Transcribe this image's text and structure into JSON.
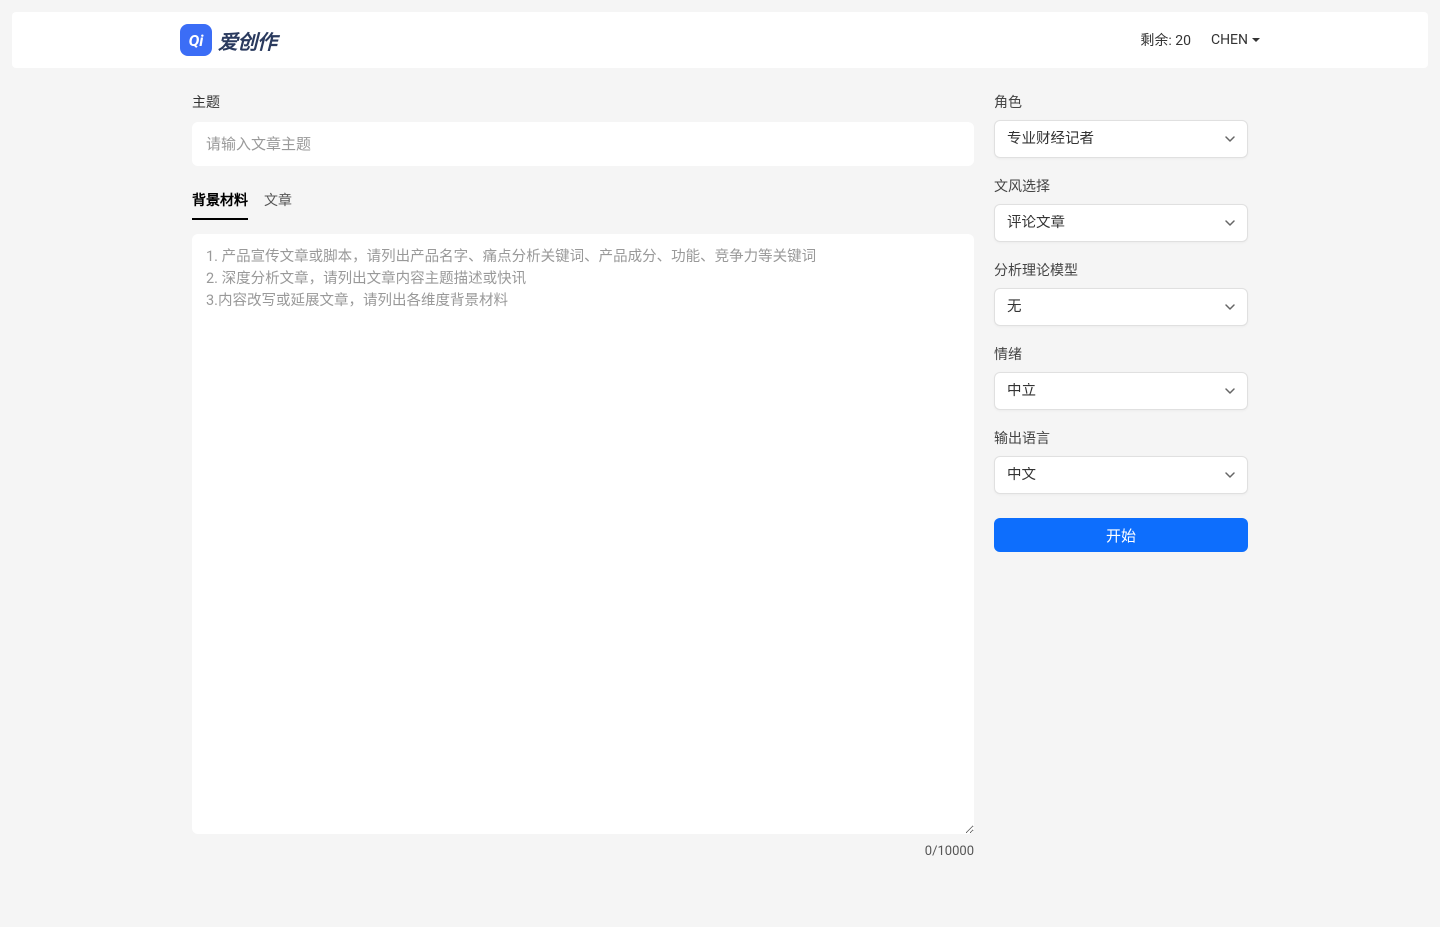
{
  "header": {
    "logo_text": "爱创作",
    "remaining_label": "剩余: 20",
    "user_name": "CHEN"
  },
  "main": {
    "topic_label": "主题",
    "topic_placeholder": "请输入文章主题",
    "tabs": {
      "background": "背景材料",
      "article": "文章"
    },
    "textarea_placeholder": "1. 产品宣传文章或脚本，请列出产品名字、痛点分析关键词、产品成分、功能、竞争力等关键词\n2. 深度分析文章，请列出文章内容主题描述或快讯\n3.内容改写或延展文章，请列出各维度背景材料",
    "char_counter": "0/10000"
  },
  "sidebar": {
    "role_label": "角色",
    "role_value": "专业财经记者",
    "style_label": "文风选择",
    "style_value": "评论文章",
    "model_label": "分析理论模型",
    "model_value": "无",
    "emotion_label": "情绪",
    "emotion_value": "中立",
    "language_label": "输出语言",
    "language_value": "中文",
    "start_button": "开始"
  }
}
